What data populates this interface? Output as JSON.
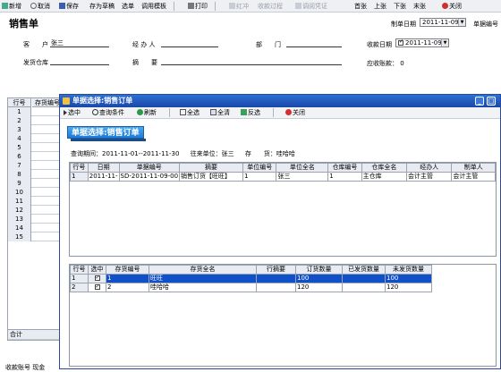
{
  "toolbar": {
    "add": "新增",
    "cancel": "取消",
    "save": "保存",
    "save_draft": "存为草稿",
    "select_order": "选单",
    "template": "调用模板",
    "print": "打印",
    "red_flush": "红冲",
    "receipt_process": "收款过程",
    "view_voucher": "调阅凭证",
    "first": "首张",
    "prev": "上张",
    "next": "下张",
    "last": "末张",
    "close": "关闭"
  },
  "form": {
    "title": "销售单",
    "date_label": "制单日期",
    "date_value": "2011-11-09",
    "doc_no_label": "单据编号",
    "customer_label": "客　　户",
    "customer_value": "张三",
    "handler_label": "经 办 人",
    "dept_label": "部　　门",
    "receive_date_label": "收款日期",
    "receive_date_value": "2011-11-09",
    "warehouse_label": "发货仓库",
    "summary_label": "摘　　要",
    "receivable_label": "应收账款：",
    "receivable_value": "0"
  },
  "bg_grid": {
    "col_seq": "行号",
    "col_code": "存货编号",
    "rows": [
      "1",
      "2",
      "3",
      "4",
      "5",
      "6",
      "7",
      "8",
      "9",
      "10",
      "11",
      "12",
      "13",
      "14",
      "15"
    ],
    "total": "合计",
    "footer": "收款账号  现金"
  },
  "dialog": {
    "title": "单据选择:销售订单",
    "toolbar": {
      "select": "选中",
      "query": "查询条件",
      "refresh": "刷新",
      "select_all": "全选",
      "clear_all": "全清",
      "invert": "反选",
      "close": "关闭"
    },
    "heading": "单据选择:销售订单",
    "query_period_label": "查询期间：",
    "query_period_value": "2011-11-01--2011-11-30",
    "partner_label": "往来单位：",
    "partner_value": "张三",
    "stock_label": "存　　货：",
    "stock_value": "哇哈哈",
    "orders": {
      "headers": [
        "行号",
        "日期",
        "单据编号",
        "摘要",
        "单位编号",
        "单位全名",
        "仓库编号",
        "仓库全名",
        "经办人",
        "制单人"
      ],
      "rows": [
        [
          "1",
          "2011-11-",
          "SD-2011-11-09-00",
          "销售订货【旺旺】",
          "1",
          "张三",
          "1",
          "主仓库",
          "会计主管",
          "会计主管"
        ]
      ]
    },
    "items": {
      "headers": [
        "行号",
        "选中",
        "存货编号",
        "存货全名",
        "行摘要",
        "订货数量",
        "已发货数量",
        "未发货数量"
      ],
      "rows": [
        [
          "1",
          "1",
          "旺旺",
          "",
          "100",
          "",
          "100"
        ],
        [
          "2",
          "2",
          "哇哈哈",
          "",
          "120",
          "",
          "120"
        ]
      ]
    }
  },
  "colors": {
    "dialog_title": "#1848a8",
    "selected_row": "#1050c8",
    "heading": "#1e7bd8"
  }
}
